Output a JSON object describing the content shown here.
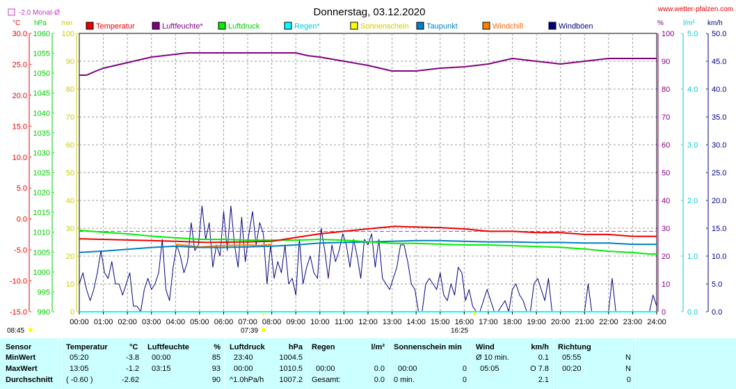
{
  "title": "Donnerstag, 03.12.2020",
  "site_link": "www.wetter-pfalzen.com",
  "month_avg_label": "-2.0 Monat-Ø",
  "colors": {
    "temp": "#ee0000",
    "hum": "#800080",
    "press": "#00ee00",
    "rain": "#00ffff",
    "sun": "#ffff00",
    "dew": "#0080c0",
    "chill": "#ff8000",
    "gust": "#000080",
    "table_bg": "#ccffff",
    "month_avg": "#cc33cc"
  },
  "axis_units": {
    "temp": "°C",
    "press": "hPa",
    "sun": "min",
    "hum": "%",
    "rain": "l/m²",
    "wind": "km/h"
  },
  "legend": [
    "Temperatur",
    "Luftfeuchte*",
    "Luftdruck",
    "Regen*",
    "Sonnenschein",
    "Taupunkt",
    "Windchill",
    "Windböen"
  ],
  "sunrise_label": "07:39",
  "sunset_label": "16:25",
  "time_corner": "08:45",
  "chart_data": {
    "type": "line",
    "title": "Donnerstag, 03.12.2020",
    "x_ticks": [
      "00:00",
      "01:00",
      "02:00",
      "03:00",
      "04:00",
      "05:00",
      "06:00",
      "07:00",
      "08:00",
      "09:00",
      "10:00",
      "11:00",
      "12:00",
      "13:00",
      "14:00",
      "15:00",
      "16:00",
      "17:00",
      "18:00",
      "19:00",
      "20:00",
      "21:00",
      "22:00",
      "23:00",
      "24:00"
    ],
    "x_range_hours": [
      0,
      24
    ],
    "axes": {
      "temp_c": {
        "range": [
          -15,
          30
        ],
        "ticks": [
          "30.0",
          "25.0",
          "20.0",
          "15.0",
          "10.0",
          "5.0",
          "0.0",
          "-5.0",
          "-10.0",
          "-15.0"
        ]
      },
      "press_hpa": {
        "range": [
          990,
          1060
        ],
        "ticks": [
          "1060",
          "1055",
          "1050",
          "1045",
          "1040",
          "1035",
          "1030",
          "1025",
          "1020",
          "1015",
          "1010",
          "1005",
          "1000",
          "995",
          "990"
        ]
      },
      "sun_min": {
        "range": [
          0,
          100
        ],
        "ticks": [
          "100",
          "90",
          "80",
          "70",
          "60",
          "50",
          "40",
          "30",
          "20",
          "10",
          "0"
        ]
      },
      "hum_pct": {
        "range": [
          0,
          100
        ],
        "ticks": [
          "100",
          "90",
          "80",
          "70",
          "60",
          "50",
          "40",
          "30",
          "20",
          "10",
          "0"
        ]
      },
      "rain_l": {
        "range": [
          0,
          5
        ],
        "ticks": [
          "5.0",
          "4.0",
          "3.0",
          "2.0",
          "1.0",
          "0.0"
        ]
      },
      "wind_kmh": {
        "range": [
          0,
          50
        ],
        "ticks": [
          "50.0",
          "45.0",
          "40.0",
          "35.0",
          "30.0",
          "25.0",
          "20.0",
          "15.0",
          "10.0",
          "5.0",
          "0.0"
        ]
      }
    },
    "month_avg_temp": -2.0,
    "series": [
      {
        "name": "Luftfeuchte*",
        "axis": "hum_pct",
        "points": [
          [
            0,
            85
          ],
          [
            0.3,
            85
          ],
          [
            0.7,
            86.5
          ],
          [
            1,
            87.5
          ],
          [
            2,
            89.5
          ],
          [
            3,
            91.5
          ],
          [
            4,
            92.5
          ],
          [
            4.5,
            93
          ],
          [
            9,
            93
          ],
          [
            9.5,
            92
          ],
          [
            10,
            91.5
          ],
          [
            11,
            90
          ],
          [
            12,
            88.5
          ],
          [
            13,
            86.5
          ],
          [
            13.5,
            86.5
          ],
          [
            14,
            86.5
          ],
          [
            15,
            87.5
          ],
          [
            16,
            88
          ],
          [
            17,
            89
          ],
          [
            18,
            91
          ],
          [
            18.5,
            90.5
          ],
          [
            19.5,
            89.5
          ],
          [
            20,
            89
          ],
          [
            21,
            90
          ],
          [
            22,
            91
          ],
          [
            24,
            91
          ]
        ]
      },
      {
        "name": "Temperatur",
        "axis": "temp_c",
        "points": [
          [
            0,
            -3.2
          ],
          [
            2,
            -3.4
          ],
          [
            3,
            -3.5
          ],
          [
            4,
            -3.6
          ],
          [
            5.3,
            -3.8
          ],
          [
            7,
            -3.7
          ],
          [
            8,
            -3.6
          ],
          [
            9,
            -3.0
          ],
          [
            10,
            -2.4
          ],
          [
            11,
            -2.0
          ],
          [
            12,
            -1.6
          ],
          [
            13.1,
            -1.2
          ],
          [
            14,
            -1.3
          ],
          [
            15,
            -1.4
          ],
          [
            16,
            -1.6
          ],
          [
            17,
            -2.0
          ],
          [
            18,
            -2.0
          ],
          [
            19,
            -2.2
          ],
          [
            20,
            -2.2
          ],
          [
            21,
            -2.5
          ],
          [
            22,
            -2.5
          ],
          [
            23,
            -2.8
          ],
          [
            24,
            -2.8
          ]
        ]
      },
      {
        "name": "Luftdruck",
        "axis": "press_hpa",
        "points": [
          [
            0,
            1010.5
          ],
          [
            1,
            1010.0
          ],
          [
            2,
            1009.6
          ],
          [
            3,
            1009.0
          ],
          [
            4,
            1008.6
          ],
          [
            5,
            1008.2
          ],
          [
            6,
            1008.2
          ],
          [
            7,
            1008.0
          ],
          [
            8,
            1008.0
          ],
          [
            9,
            1008.0
          ],
          [
            10,
            1008.2
          ],
          [
            11,
            1008.0
          ],
          [
            12,
            1007.6
          ],
          [
            13,
            1007.2
          ],
          [
            14,
            1007.2
          ],
          [
            15,
            1007.0
          ],
          [
            16,
            1006.8
          ],
          [
            17,
            1006.8
          ],
          [
            18,
            1006.6
          ],
          [
            19,
            1006.4
          ],
          [
            20,
            1006.2
          ],
          [
            21,
            1005.8
          ],
          [
            22,
            1005.2
          ],
          [
            23,
            1004.9
          ],
          [
            23.7,
            1004.5
          ],
          [
            24,
            1004.5
          ]
        ]
      },
      {
        "name": "Taupunkt",
        "axis": "temp_c",
        "points": [
          [
            0,
            -5.4
          ],
          [
            1,
            -5.2
          ],
          [
            2,
            -4.9
          ],
          [
            3,
            -4.6
          ],
          [
            4,
            -4.4
          ],
          [
            5,
            -4.6
          ],
          [
            6,
            -4.6
          ],
          [
            7,
            -4.5
          ],
          [
            8,
            -4.4
          ],
          [
            9,
            -4.2
          ],
          [
            10,
            -3.9
          ],
          [
            11,
            -3.8
          ],
          [
            12,
            -3.7
          ],
          [
            13,
            -3.6
          ],
          [
            14,
            -3.5
          ],
          [
            15,
            -3.5
          ],
          [
            16,
            -3.6
          ],
          [
            17,
            -3.7
          ],
          [
            18,
            -3.7
          ],
          [
            19,
            -3.8
          ],
          [
            20,
            -3.8
          ],
          [
            21,
            -3.9
          ],
          [
            22,
            -3.9
          ],
          [
            23,
            -4.1
          ],
          [
            24,
            -4.1
          ]
        ]
      },
      {
        "name": "Windchill",
        "axis": "temp_c",
        "points": [
          [
            4,
            -4.1
          ],
          [
            4.5,
            -4.3
          ],
          [
            5,
            -4.5
          ],
          [
            5.5,
            -4.4
          ],
          [
            6,
            -4.3
          ],
          [
            7,
            -4.2
          ],
          [
            7.5,
            -4.3
          ],
          [
            8,
            -4.1
          ]
        ]
      },
      {
        "name": "Regen*",
        "axis": "rain_l",
        "points": [
          [
            0,
            0
          ],
          [
            24,
            0
          ]
        ]
      },
      {
        "name": "Windböen",
        "axis": "wind_kmh",
        "points": [
          [
            0,
            5
          ],
          [
            0.15,
            7
          ],
          [
            0.3,
            4
          ],
          [
            0.45,
            2
          ],
          [
            0.6,
            4
          ],
          [
            0.75,
            7
          ],
          [
            0.9,
            11
          ],
          [
            1.05,
            7
          ],
          [
            1.2,
            6
          ],
          [
            1.35,
            9
          ],
          [
            1.5,
            5
          ],
          [
            1.65,
            5
          ],
          [
            1.8,
            3
          ],
          [
            1.95,
            5
          ],
          [
            2.1,
            7
          ],
          [
            2.25,
            1
          ],
          [
            2.4,
            1
          ],
          [
            2.55,
            0
          ],
          [
            2.7,
            4
          ],
          [
            2.85,
            6
          ],
          [
            3.0,
            4
          ],
          [
            3.15,
            5
          ],
          [
            3.3,
            7
          ],
          [
            3.45,
            13
          ],
          [
            3.6,
            4
          ],
          [
            3.75,
            2
          ],
          [
            3.9,
            8
          ],
          [
            4.05,
            12
          ],
          [
            4.2,
            10
          ],
          [
            4.35,
            7
          ],
          [
            4.5,
            9
          ],
          [
            4.65,
            16
          ],
          [
            4.8,
            11
          ],
          [
            4.95,
            12
          ],
          [
            5.1,
            19
          ],
          [
            5.25,
            13
          ],
          [
            5.4,
            16
          ],
          [
            5.55,
            8
          ],
          [
            5.7,
            12
          ],
          [
            5.85,
            10
          ],
          [
            6.0,
            18
          ],
          [
            6.15,
            11
          ],
          [
            6.3,
            19
          ],
          [
            6.45,
            12
          ],
          [
            6.6,
            8
          ],
          [
            6.75,
            17
          ],
          [
            6.9,
            9
          ],
          [
            7.05,
            14
          ],
          [
            7.2,
            18
          ],
          [
            7.35,
            12
          ],
          [
            7.5,
            16
          ],
          [
            7.65,
            14
          ],
          [
            7.8,
            5
          ],
          [
            7.95,
            12
          ],
          [
            8.1,
            6
          ],
          [
            8.25,
            9
          ],
          [
            8.4,
            7
          ],
          [
            8.55,
            12
          ],
          [
            8.7,
            5
          ],
          [
            8.85,
            6
          ],
          [
            9.0,
            3
          ],
          [
            9.15,
            13
          ],
          [
            9.3,
            5
          ],
          [
            9.45,
            8
          ],
          [
            9.6,
            10
          ],
          [
            9.75,
            7
          ],
          [
            9.9,
            6
          ],
          [
            10.05,
            15
          ],
          [
            10.2,
            11
          ],
          [
            10.35,
            6
          ],
          [
            10.5,
            12
          ],
          [
            10.65,
            9
          ],
          [
            10.8,
            11
          ],
          [
            10.95,
            14
          ],
          [
            11.1,
            12
          ],
          [
            11.25,
            8
          ],
          [
            11.4,
            13
          ],
          [
            11.55,
            10
          ],
          [
            11.7,
            6
          ],
          [
            11.85,
            13
          ],
          [
            12.0,
            12
          ],
          [
            12.15,
            14
          ],
          [
            12.3,
            8
          ],
          [
            12.45,
            13
          ],
          [
            12.6,
            6
          ],
          [
            12.75,
            5
          ],
          [
            12.9,
            4
          ],
          [
            13.05,
            6
          ],
          [
            13.2,
            8
          ],
          [
            13.35,
            12
          ],
          [
            13.5,
            12
          ],
          [
            13.65,
            9
          ],
          [
            13.8,
            5
          ],
          [
            13.95,
            4
          ],
          [
            14.1,
            0
          ],
          [
            14.25,
            0
          ],
          [
            14.4,
            5
          ],
          [
            14.55,
            6
          ],
          [
            14.7,
            5
          ],
          [
            14.85,
            4
          ],
          [
            15.0,
            7
          ],
          [
            15.15,
            3
          ],
          [
            15.3,
            2
          ],
          [
            15.45,
            5
          ],
          [
            15.6,
            3
          ],
          [
            15.75,
            8
          ],
          [
            15.9,
            7
          ],
          [
            16.05,
            2
          ],
          [
            16.2,
            4
          ],
          [
            16.35,
            1
          ],
          [
            16.5,
            0
          ],
          [
            16.65,
            0
          ],
          [
            16.8,
            2
          ],
          [
            16.95,
            4
          ],
          [
            17.1,
            2
          ],
          [
            17.25,
            0
          ],
          [
            17.4,
            0
          ],
          [
            17.55,
            1
          ],
          [
            17.7,
            2
          ],
          [
            17.85,
            0
          ],
          [
            18.0,
            4
          ],
          [
            18.15,
            5
          ],
          [
            18.3,
            3
          ],
          [
            18.45,
            2
          ],
          [
            18.6,
            0
          ],
          [
            18.75,
            0
          ],
          [
            18.9,
            5
          ],
          [
            19.05,
            6
          ],
          [
            19.2,
            4
          ],
          [
            19.35,
            2
          ],
          [
            19.5,
            6
          ],
          [
            19.65,
            0
          ],
          [
            19.8,
            0
          ],
          [
            20.5,
            0
          ],
          [
            21.0,
            0
          ],
          [
            21.15,
            5
          ],
          [
            21.3,
            0
          ],
          [
            22.0,
            0
          ],
          [
            22.15,
            6
          ],
          [
            22.3,
            0
          ],
          [
            23.7,
            0
          ],
          [
            23.85,
            3
          ],
          [
            24.0,
            1
          ]
        ]
      }
    ]
  },
  "table": {
    "row_labels": [
      "Sensor",
      "MinWert",
      "MaxWert",
      "Durchschnitt"
    ],
    "temp": {
      "head": "Temperatur",
      "unit": "°C",
      "min_time": "05:20",
      "min": "-3.8",
      "max_time": "13:05",
      "max": "-1.2",
      "avg_note": "( -0.60 )",
      "avg": "-2.62"
    },
    "hum": {
      "head": "Luftfeuchte",
      "unit": "%",
      "min_time": "00:00",
      "min": "85",
      "max_time": "03:15",
      "max": "93",
      "avg": "90"
    },
    "press": {
      "head": "Luftdruck",
      "unit": "hPa",
      "min_time": "23:40",
      "min": "1004.5",
      "max_time": "00:00",
      "max": "1010.5",
      "avg_note": "^1.0hPa/h",
      "avg": "1007.2"
    },
    "rain": {
      "head": "Regen",
      "unit": "l/m²",
      "max_time": "00:00",
      "max": "0.0",
      "avg_note": "Gesamt:",
      "avg": "0.0"
    },
    "sun": {
      "head": "Sonnenschein min",
      "max_time": "00:00",
      "max": "0",
      "avg_note": "0 min.",
      "avg": "0"
    },
    "wind": {
      "head": "Wind",
      "unit": "km/h",
      "min_time": "Ø 10 min.",
      "min": "0.1",
      "max_time": "05:05",
      "max": "O 7.8",
      "avg": "2.1"
    },
    "dir": {
      "head": "Richtung",
      "min_time": "05:55",
      "min": "N",
      "max_time": "00:20",
      "max": "N",
      "avg": "0"
    }
  }
}
